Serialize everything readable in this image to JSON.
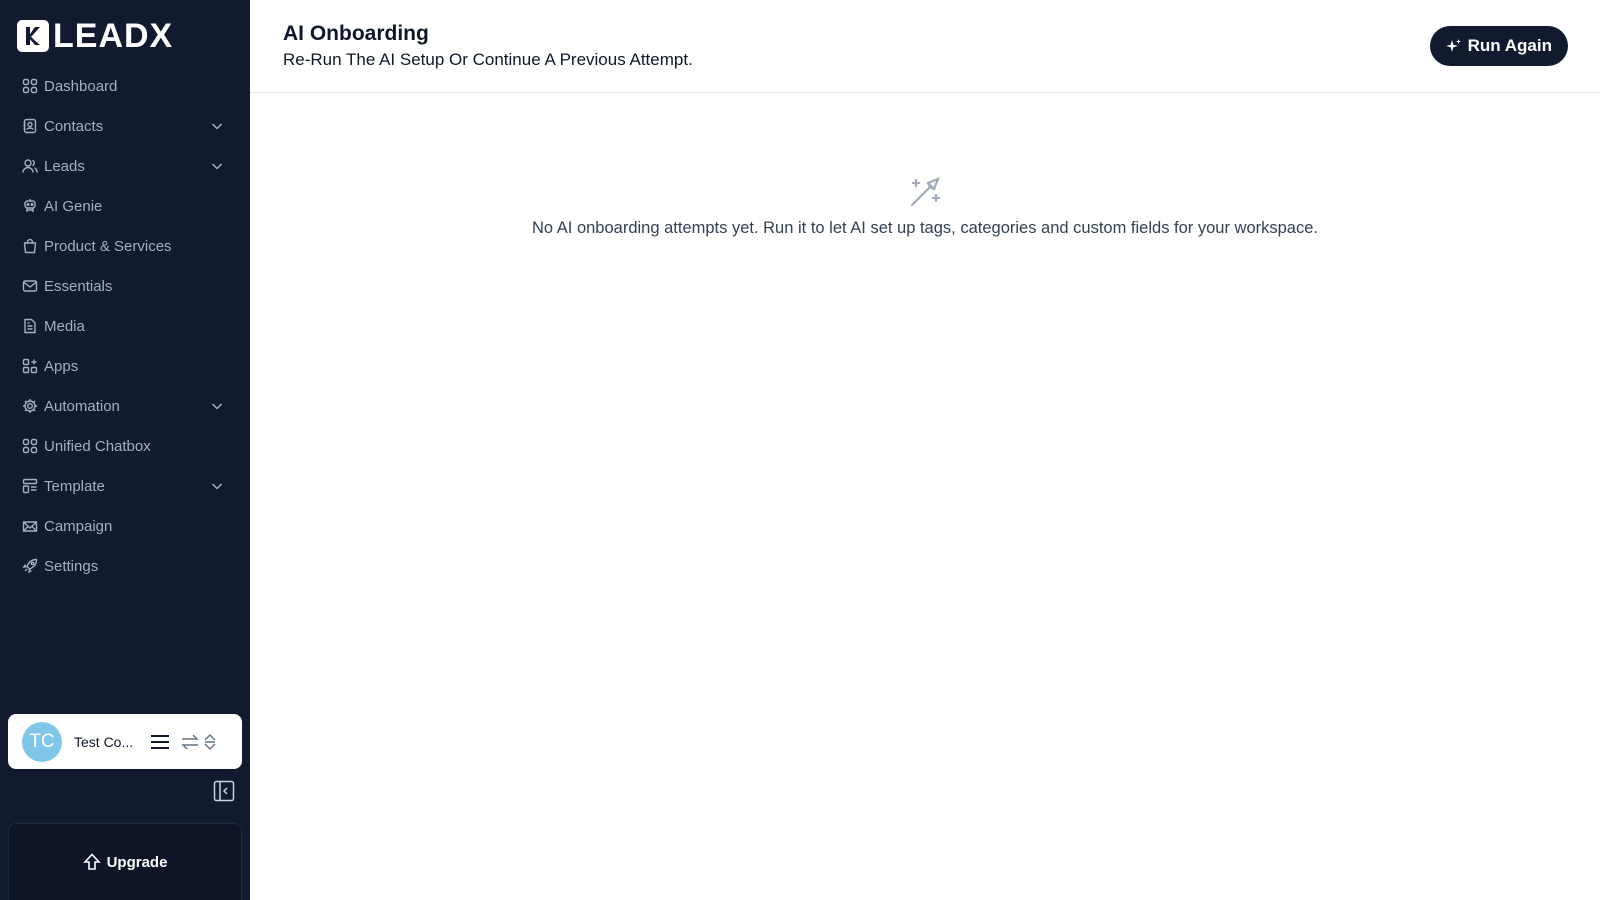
{
  "brand": {
    "name": "LEADX"
  },
  "sidebar": {
    "items": [
      {
        "label": "Dashboard",
        "icon": "grid-icon",
        "expandable": false
      },
      {
        "label": "Contacts",
        "icon": "contact-card-icon",
        "expandable": true
      },
      {
        "label": "Leads",
        "icon": "users-icon",
        "expandable": true
      },
      {
        "label": "AI Genie",
        "icon": "robot-icon",
        "expandable": false
      },
      {
        "label": "Product & Services",
        "icon": "shopping-bag-icon",
        "expandable": false
      },
      {
        "label": "Essentials",
        "icon": "mail-icon",
        "expandable": false
      },
      {
        "label": "Media",
        "icon": "file-icon",
        "expandable": false
      },
      {
        "label": "Apps",
        "icon": "apps-icon",
        "expandable": false
      },
      {
        "label": "Automation",
        "icon": "gear-icon",
        "expandable": true
      },
      {
        "label": "Unified Chatbox",
        "icon": "grid-icon",
        "expandable": false
      },
      {
        "label": "Template",
        "icon": "template-icon",
        "expandable": true
      },
      {
        "label": "Campaign",
        "icon": "envelope-open-icon",
        "expandable": false
      },
      {
        "label": "Settings",
        "icon": "rocket-icon",
        "expandable": false
      }
    ]
  },
  "account": {
    "initials": "TC",
    "name": "Test Co..."
  },
  "upgrade": {
    "label": "Upgrade"
  },
  "header": {
    "title": "AI Onboarding",
    "subtitle": "Re-Run The AI Setup Or Continue A Previous Attempt.",
    "run_again_label": "Run Again"
  },
  "empty_state": {
    "icon": "magic-wand-icon",
    "message": "No AI onboarding attempts yet. Run it to let AI set up tags, categories and custom fields for your workspace."
  },
  "colors": {
    "sidebar_bg": "#111a2e",
    "nav_text": "#a7b0c0",
    "button_bg": "#111a2e",
    "avatar_bg": "#7fc6e8"
  }
}
